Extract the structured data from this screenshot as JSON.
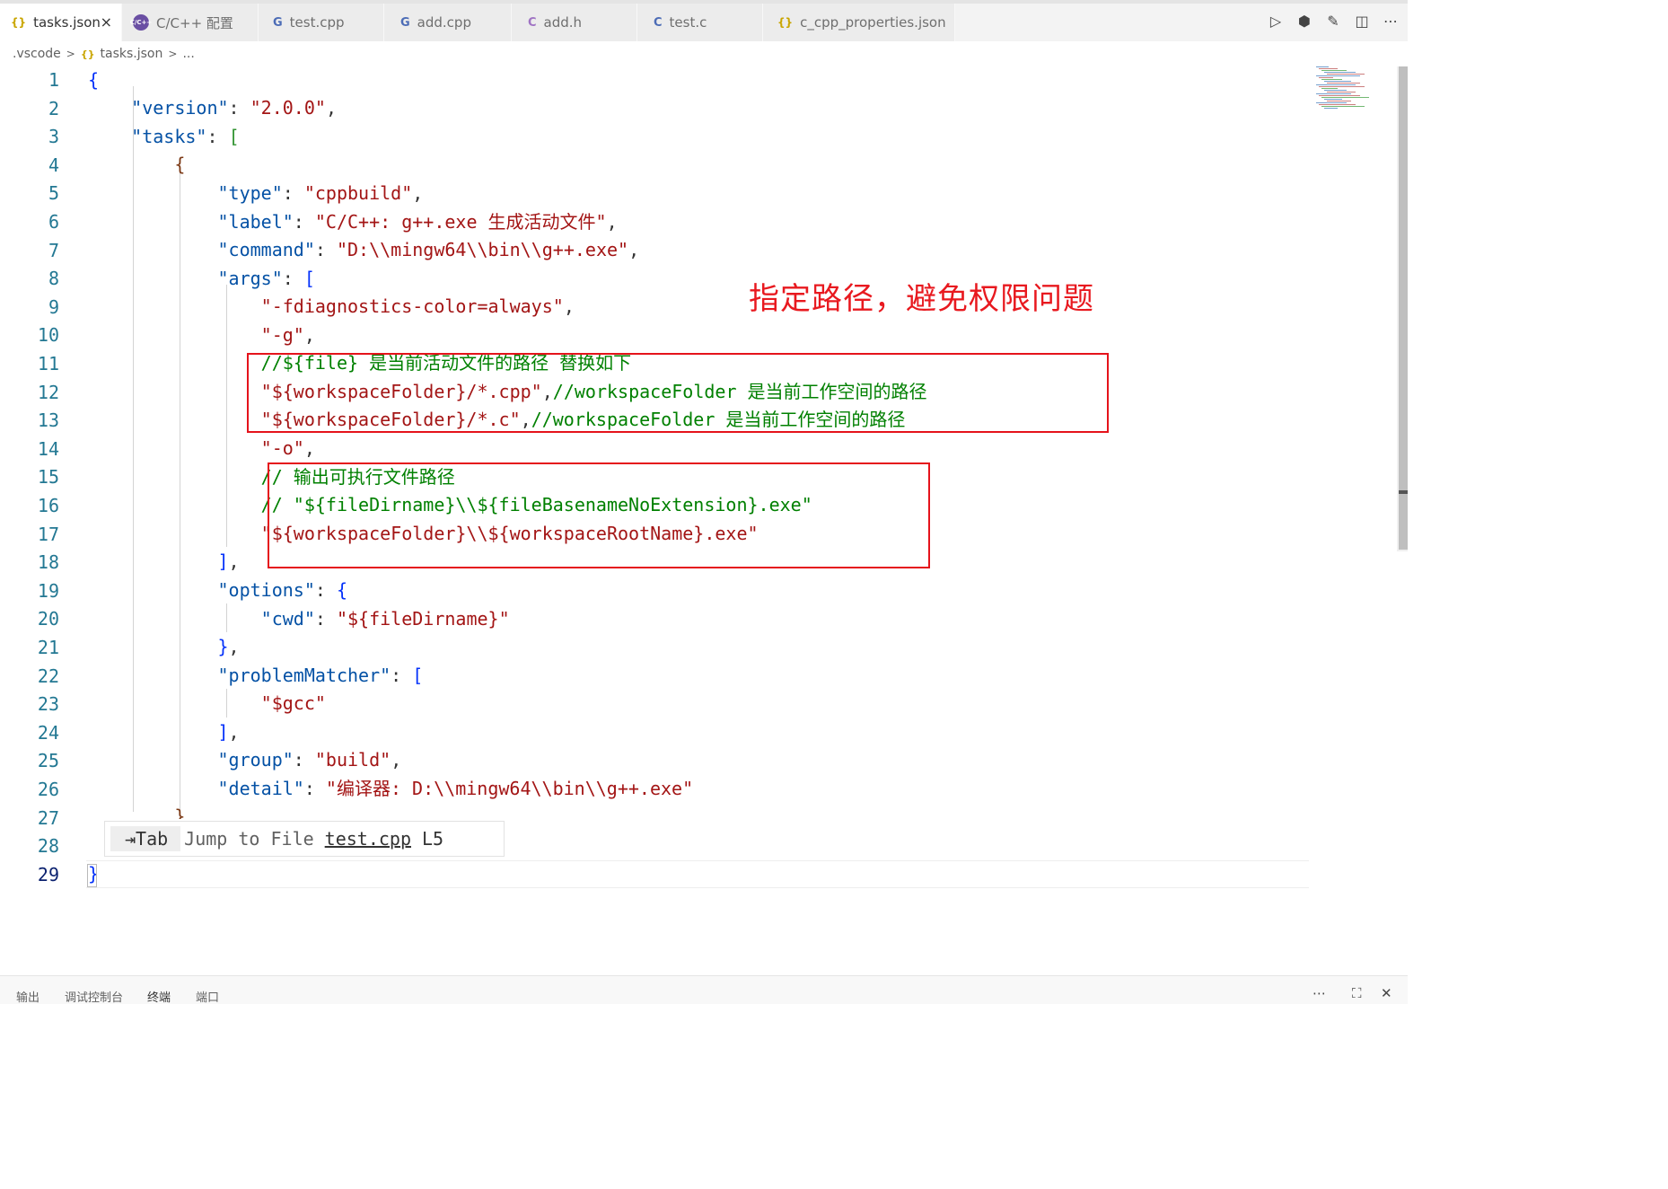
{
  "tabs": [
    {
      "icon": "json-braces-icon",
      "glyph": "{}",
      "label": "tasks.json",
      "active": true
    },
    {
      "icon": "cpp-config-icon",
      "glyph": "C/C++",
      "label": "C/C++ 配置"
    },
    {
      "icon": "cpp-file-icon",
      "glyph": "G",
      "label": "test.cpp"
    },
    {
      "icon": "cpp-file-icon",
      "glyph": "G",
      "label": "add.cpp"
    },
    {
      "icon": "c-header-icon",
      "glyph": "C",
      "label": "add.h"
    },
    {
      "icon": "c-file-icon",
      "glyph": "C",
      "label": "test.c"
    },
    {
      "icon": "json-braces-icon",
      "glyph": "{}",
      "label": "c_cpp_properties.json"
    }
  ],
  "tab_close_glyph": "×",
  "editor_actions": [
    {
      "name": "run-icon",
      "glyph": "▷"
    },
    {
      "name": "debug-config-icon",
      "glyph": "⬢"
    },
    {
      "name": "edit-icon",
      "glyph": "✎"
    },
    {
      "name": "split-editor-icon",
      "glyph": "◫"
    },
    {
      "name": "more-actions-icon",
      "glyph": "⋯"
    }
  ],
  "breadcrumb": {
    "folder": ".vscode",
    "file_icon": "{}",
    "file": "tasks.json",
    "tail": "...",
    "sep": ">"
  },
  "line_numbers": [
    "1",
    "2",
    "3",
    "4",
    "5",
    "6",
    "7",
    "8",
    "9",
    "10",
    "11",
    "12",
    "13",
    "14",
    "15",
    "16",
    "17",
    "18",
    "19",
    "20",
    "21",
    "22",
    "23",
    "24",
    "25",
    "26",
    "27",
    "28",
    "29"
  ],
  "code": {
    "l1": "{",
    "l2_k": "\"version\"",
    "l2_v": "\"2.0.0\"",
    "l3_k": "\"tasks\"",
    "l3_b": "[",
    "l4": "{",
    "l5_k": "\"type\"",
    "l5_v": "\"cppbuild\"",
    "l6_k": "\"label\"",
    "l6_v": "\"C/C++: g++.exe 生成活动文件\"",
    "l7_k": "\"command\"",
    "l7_v": "\"D:\\\\mingw64\\\\bin\\\\g++.exe\"",
    "l8_k": "\"args\"",
    "l8_b": "[",
    "l9": "\"-fdiagnostics-color=always\"",
    "l10": "\"-g\"",
    "l11": "//${file} 是当前活动文件的路径 替换如下",
    "l12_v": "\"${workspaceFolder}/*.cpp\"",
    "l12_c": "//workspaceFolder 是当前工作空间的路径",
    "l13_v": "\"${workspaceFolder}/*.c\"",
    "l13_c": "//workspaceFolder 是当前工作空间的路径",
    "l14": "\"-o\"",
    "l15": "// 输出可执行文件路径",
    "l16": "// \"${fileDirname}\\\\${fileBasenameNoExtension}.exe\"",
    "l17": "\"${workspaceFolder}\\\\${workspaceRootName}.exe\"",
    "l18": "]",
    "l19_k": "\"options\"",
    "l19_b": "{",
    "l20_k": "\"cwd\"",
    "l20_v": "\"${fileDirname}\"",
    "l21": "}",
    "l22_k": "\"problemMatcher\"",
    "l22_b": "[",
    "l23": "\"$gcc\"",
    "l24": "]",
    "l25_k": "\"group\"",
    "l25_v": "\"build\"",
    "l26_k": "\"detail\"",
    "l26_v": "\"编译器: D:\\\\mingw64\\\\bin\\\\g++.exe\"",
    "l27": "}",
    "l29": "}"
  },
  "hint": {
    "key": "⇥Tab",
    "text": "Jump to File",
    "file": "test.cpp",
    "line": "L5"
  },
  "annotation": "指定路径，避免权限问题",
  "panel": {
    "tabs": [
      "输出",
      "调试控制台",
      "终端",
      "端口"
    ],
    "more": "⋯",
    "maximize": "⛶",
    "close": "✕"
  },
  "colors": {
    "annotation": "#e8191f",
    "key": "#0451a5",
    "string": "#a31515",
    "comment": "#008000",
    "line_number": "#237893"
  }
}
